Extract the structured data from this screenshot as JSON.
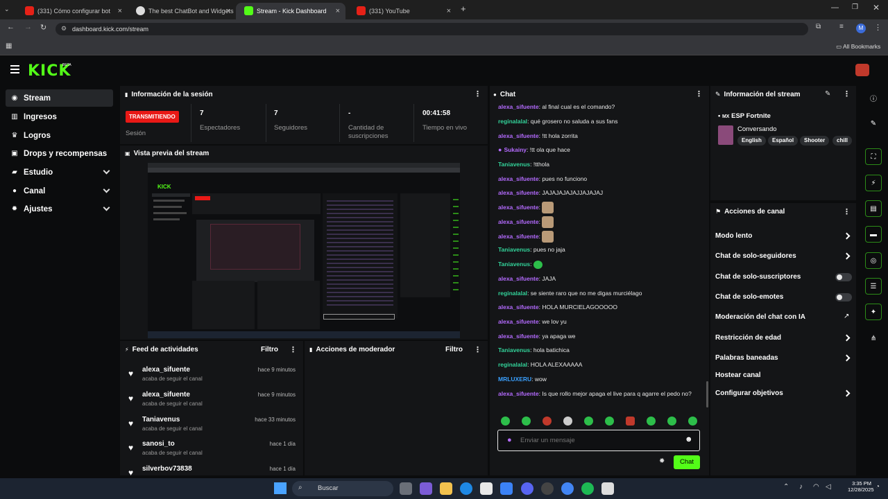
{
  "browser": {
    "tabs": [
      {
        "label": "(331) Cómo configurar bot"
      },
      {
        "label": "The best ChatBot and Widgets"
      },
      {
        "label": "Stream - Kick Dashboard"
      },
      {
        "label": "(331) YouTube"
      }
    ],
    "url": "dashboard.kick.com/stream",
    "bookmarks_label": "All Bookmarks",
    "profile_initial": "M"
  },
  "brand": {
    "logo": "KICK",
    "badge": "BETA"
  },
  "sidebar": {
    "items": [
      {
        "label": "Stream",
        "icon": "stream-icon"
      },
      {
        "label": "Ingresos",
        "icon": "bank-icon"
      },
      {
        "label": "Logros",
        "icon": "trophy-icon"
      },
      {
        "label": "Drops y recompensas",
        "icon": "gift-icon"
      },
      {
        "label": "Estudio",
        "icon": "camera-icon"
      },
      {
        "label": "Canal",
        "icon": "user-icon"
      },
      {
        "label": "Ajustes",
        "icon": "gear-icon"
      }
    ]
  },
  "session": {
    "title": "Información de la sesión",
    "live_badge": "TRANSMITIENDO",
    "session_label": "Sesión",
    "stats": [
      {
        "value": "7",
        "label": "Espectadores"
      },
      {
        "value": "7",
        "label": "Seguidores"
      },
      {
        "value": "-",
        "label": "Cantidad de suscripciones"
      },
      {
        "value": "00:41:58",
        "label": "Tiempo en vivo"
      }
    ]
  },
  "preview": {
    "title": "Vista previa del stream"
  },
  "feed": {
    "title": "Feed de actividades",
    "filter": "Filtro",
    "items": [
      {
        "name": "alexa_sifuente",
        "sub": "acaba de seguir el canal",
        "time": "hace 9 minutos"
      },
      {
        "name": "alexa_sifuente",
        "sub": "acaba de seguir el canal",
        "time": "hace 9 minutos"
      },
      {
        "name": "Taniavenus",
        "sub": "acaba de seguir el canal",
        "time": "hace 33 minutos"
      },
      {
        "name": "sanosi_to",
        "sub": "acaba de seguir el canal",
        "time": "hace 1 día"
      },
      {
        "name": "silverbov73838",
        "sub": "",
        "time": "hace 1 día"
      }
    ]
  },
  "mod": {
    "title": "Acciones de moderador",
    "filter": "Filtro"
  },
  "chat": {
    "title": "Chat",
    "messages": [
      {
        "user": "alexa_sifuente",
        "text": "al final cual es el comando?"
      },
      {
        "user": "reginalalal",
        "text": "qué grosero no saluda a sus fans"
      },
      {
        "user": "alexa_sifuente",
        "text": "!tt hola zorrita"
      },
      {
        "user": "Sukainy",
        "text": "!tt ola que hace"
      },
      {
        "user": "Taniavenus",
        "text": "!tthola"
      },
      {
        "user": "alexa_sifuente",
        "text": "pues no funciono"
      },
      {
        "user": "alexa_sifuente",
        "text": "JAJAJAJAJAJJAJAJAJ"
      },
      {
        "user": "alexa_sifuente",
        "text": ""
      },
      {
        "user": "alexa_sifuente",
        "text": ""
      },
      {
        "user": "alexa_sifuente",
        "text": ""
      },
      {
        "user": "Taniavenus",
        "text": "pues no jaja"
      },
      {
        "user": "Taniavenus",
        "text": ""
      },
      {
        "user": "alexa_sifuente",
        "text": "JAJA"
      },
      {
        "user": "reginalalal",
        "text": "se siente raro que no me digas murciélago"
      },
      {
        "user": "alexa_sifuente",
        "text": "HOLA MURCIELAGOOOOO"
      },
      {
        "user": "alexa_sifuente",
        "text": "we lov yu"
      },
      {
        "user": "alexa_sifuente",
        "text": "ya apaga we"
      },
      {
        "user": "Taniavenus",
        "text": "hola batichica"
      },
      {
        "user": "reginalalal",
        "text": "HOLA ALEXAAAAA"
      },
      {
        "user": "MRLUXERU",
        "text": "wow"
      },
      {
        "user": "alexa_sifuente",
        "text": "Is que rollo mejor apaga el live para q agarre el pedo no?"
      }
    ],
    "input_placeholder": "Enviar un mensaje",
    "send_label": "Chat"
  },
  "stream_info": {
    "title": "Información del stream",
    "stream_title": "ESP Fortnite",
    "country": "MX",
    "category": "Conversando",
    "tags": [
      "English",
      "Español",
      "Shooter",
      "chill"
    ]
  },
  "channel_actions": {
    "title": "Acciones de canal",
    "items": [
      {
        "label": "Modo lento",
        "control": "arrow"
      },
      {
        "label": "Chat de solo-seguidores",
        "control": "arrow"
      },
      {
        "label": "Chat de solo-suscriptores",
        "control": "toggle"
      },
      {
        "label": "Chat de solo-emotes",
        "control": "toggle"
      },
      {
        "label": "Moderación del chat con IA",
        "control": "external"
      },
      {
        "label": "Restricción de edad",
        "control": "arrow"
      },
      {
        "label": "Palabras baneadas",
        "control": "arrow"
      },
      {
        "label": "Hostear canal",
        "control": "none"
      },
      {
        "label": "Configurar objetivos",
        "control": "arrow"
      }
    ]
  },
  "taskbar": {
    "search_label": "Buscar",
    "time": "3:35 PM",
    "date": "12/28/2025"
  },
  "colors": {
    "accent": "#53fc18",
    "live": "#e91916",
    "purple_user": "#b46bff",
    "teal_user": "#33d39a"
  }
}
